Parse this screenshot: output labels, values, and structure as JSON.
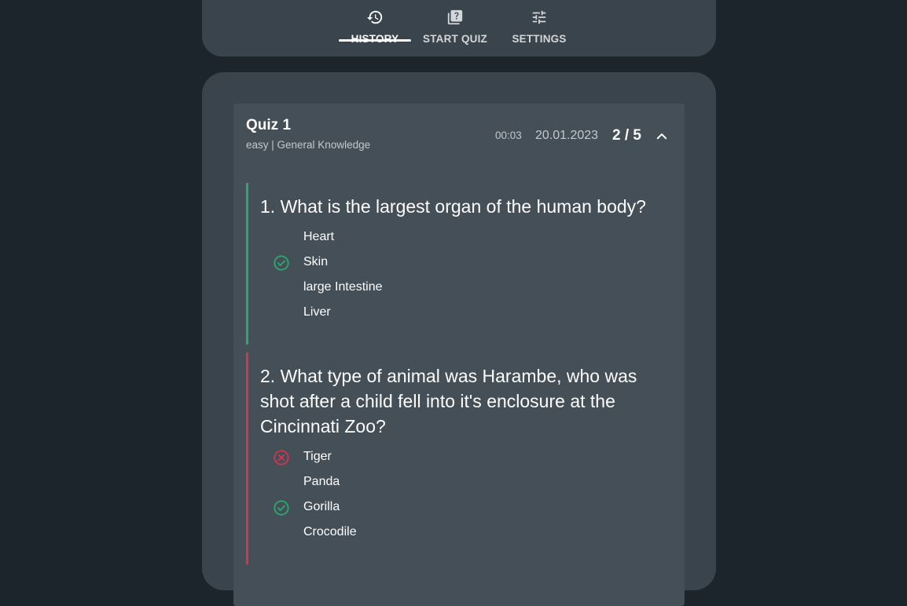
{
  "nav": {
    "tabs": [
      {
        "label": "HISTORY",
        "icon": "history-icon",
        "active": true
      },
      {
        "label": "START QUIZ",
        "icon": "quiz-icon",
        "active": false
      },
      {
        "label": "SETTINGS",
        "icon": "tune-icon",
        "active": false
      }
    ]
  },
  "colors": {
    "background": "#1c252b",
    "panel": "#3a444c",
    "card": "#444f58",
    "correct": "#2ea86a",
    "wrong": "#d1364f"
  },
  "quiz": {
    "title": "Quiz 1",
    "subtitle": "easy | General Knowledge",
    "time": "00:03",
    "date": "20.01.2023",
    "score": "2 / 5",
    "questions": [
      {
        "text": "1. What is the largest organ of the human body?",
        "result": "correct",
        "answers": [
          {
            "text": "Heart",
            "mark": ""
          },
          {
            "text": "Skin",
            "mark": "check-circle-icon"
          },
          {
            "text": "large Intestine",
            "mark": ""
          },
          {
            "text": "Liver",
            "mark": ""
          }
        ]
      },
      {
        "text": "2. What type of animal was Harambe, who was shot after a child fell into it's enclosure at the Cincinnati Zoo?",
        "result": "wrong",
        "answers": [
          {
            "text": "Tiger",
            "mark": "cross-circle-icon"
          },
          {
            "text": "Panda",
            "mark": ""
          },
          {
            "text": "Gorilla",
            "mark": "check-circle-icon"
          },
          {
            "text": "Crocodile",
            "mark": ""
          }
        ]
      }
    ]
  }
}
